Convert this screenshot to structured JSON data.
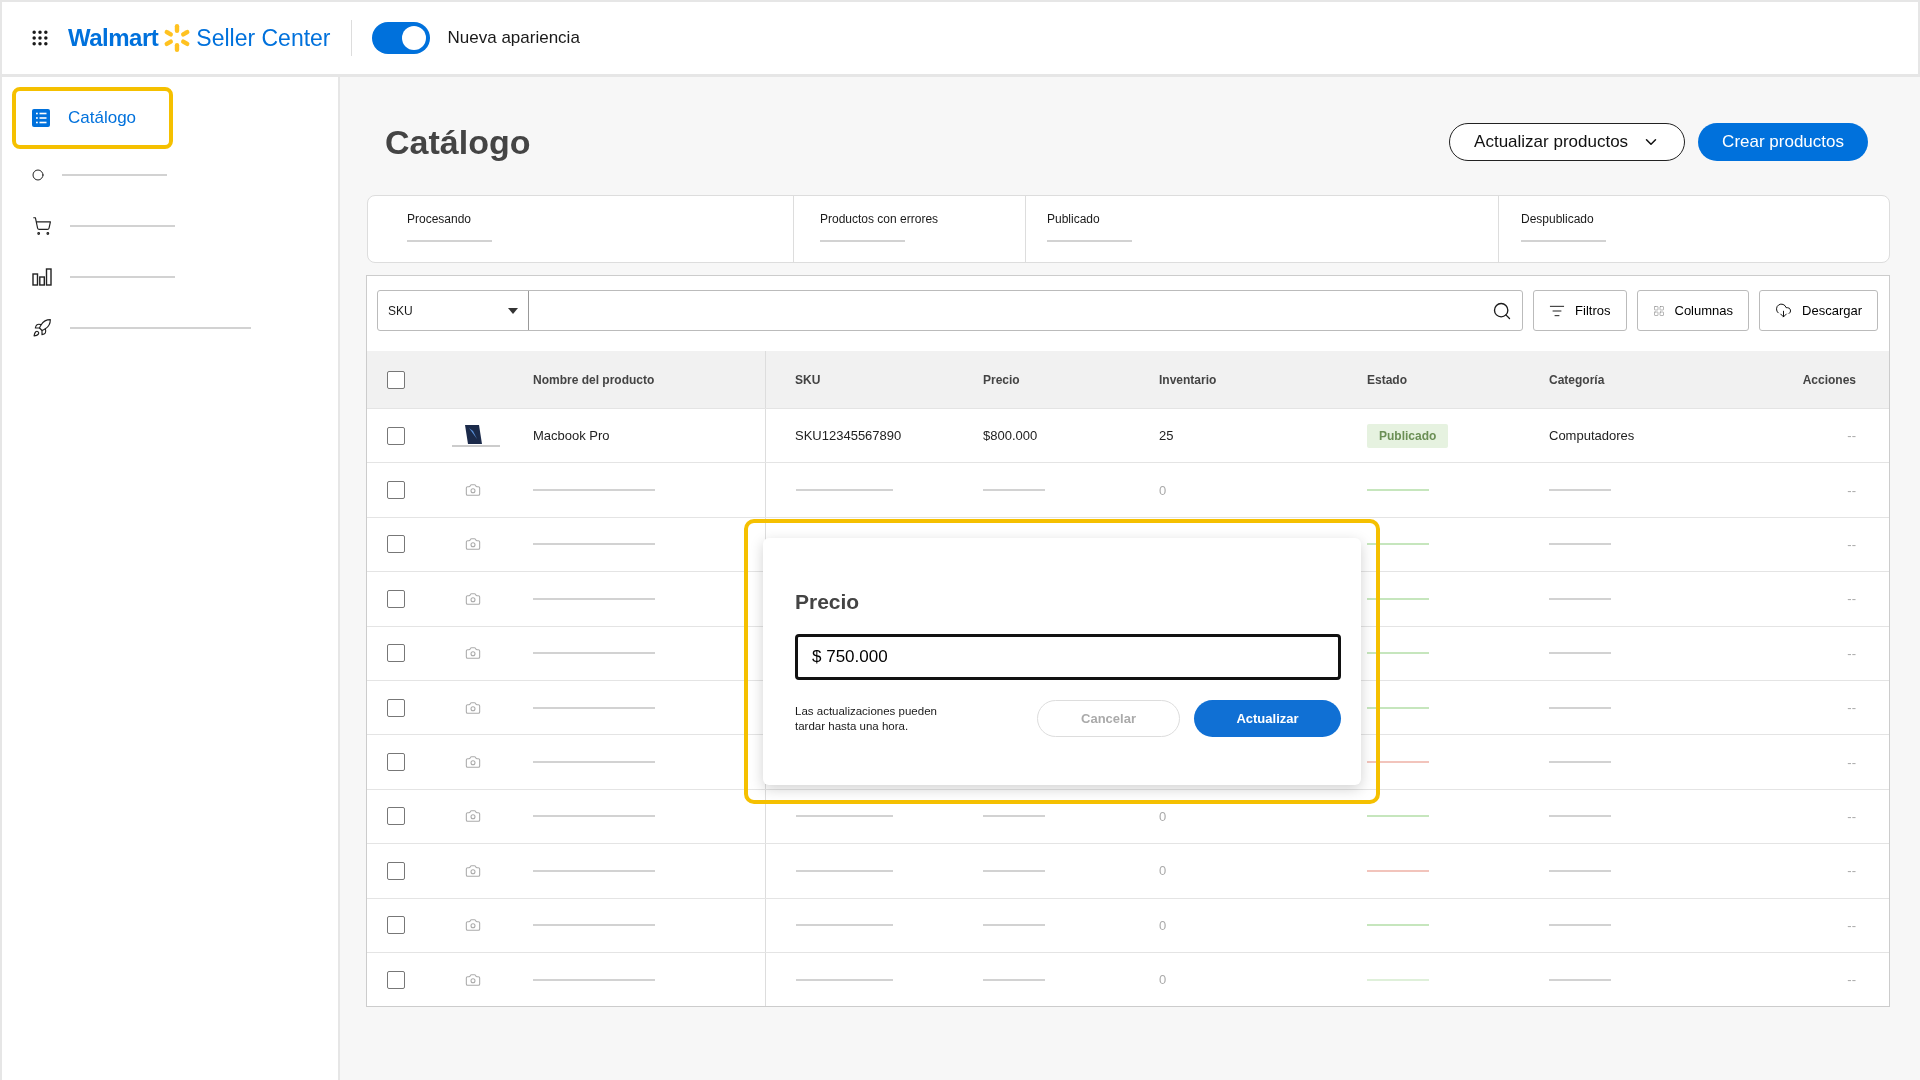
{
  "header": {
    "brand": "Walmart",
    "product": "Seller Center",
    "toggle": {
      "label": "Nueva apariencia",
      "on": true
    }
  },
  "sidebar": {
    "items": [
      {
        "label": "Catálogo",
        "selected": true,
        "highlighted": true
      },
      {
        "selected": false,
        "highlighted": false
      },
      {
        "selected": false,
        "highlighted": false
      },
      {
        "selected": false,
        "highlighted": false
      },
      {
        "selected": false,
        "highlighted": false
      }
    ]
  },
  "page": {
    "title": "Catálogo",
    "actions": [
      {
        "label": "Actualizar productos",
        "kind": "dropdown"
      },
      {
        "label": "Crear productos",
        "kind": "primary"
      }
    ]
  },
  "status_tabs": [
    {
      "label": "Procesando"
    },
    {
      "label": "Productos con errores"
    },
    {
      "label": "Publicado"
    },
    {
      "label": "Despublicado"
    }
  ],
  "toolbar": {
    "search_by": "SKU",
    "tools": [
      {
        "label": "Filtros",
        "kind": "filter"
      },
      {
        "label": "Columnas",
        "kind": "columns"
      },
      {
        "label": "Descargar",
        "kind": "download"
      }
    ]
  },
  "table": {
    "select_all": {
      "checked": false
    },
    "columns": [
      "Nombre del producto",
      "SKU",
      "Precio",
      "Inventario",
      "Estado",
      "Categoría",
      "Acciones"
    ],
    "rows": [
      {
        "kind": "product",
        "checked": false,
        "name": "Macbook Pro",
        "sku": "SKU12345567890",
        "price": "$800.000",
        "inventory": "25",
        "status": "Publicado",
        "category": "Computadores",
        "actions": "--"
      },
      {
        "kind": "placeholder",
        "checked": false,
        "inventory": "0",
        "color": "#c6e6bd",
        "actions": "--"
      },
      {
        "kind": "placeholder",
        "checked": false,
        "color": "#c6e6bd",
        "actions": "--"
      },
      {
        "kind": "placeholder",
        "checked": false,
        "color": "#c6e6bd",
        "actions": "--"
      },
      {
        "kind": "placeholder",
        "checked": false,
        "color": "#c6e6bd",
        "actions": "--"
      },
      {
        "kind": "placeholder",
        "checked": false,
        "color": "#c6e6bd",
        "actions": "--"
      },
      {
        "kind": "placeholder",
        "checked": false,
        "color": "#f2c4bc",
        "actions": "--"
      },
      {
        "kind": "placeholder",
        "checked": false,
        "inventory": "0",
        "color": "#c6e6bd",
        "actions": "--"
      },
      {
        "kind": "placeholder",
        "checked": false,
        "inventory": "0",
        "color": "#f2c4bc",
        "actions": "--"
      },
      {
        "kind": "placeholder",
        "checked": false,
        "inventory": "0",
        "color": "#c6e6bd",
        "actions": "--"
      },
      {
        "kind": "placeholder",
        "checked": false,
        "inventory": "0",
        "color": "#dff0da",
        "actions": "--"
      }
    ]
  },
  "dialog": {
    "highlighted": true,
    "title": "Precio",
    "value": "$ 750.000",
    "note": "Las actualizaciones pueden tardar hasta una hora.",
    "buttons": [
      {
        "label": "Cancelar",
        "kind": "secondary",
        "disabled": true
      },
      {
        "label": "Actualizar",
        "kind": "primary",
        "disabled": false
      }
    ]
  }
}
